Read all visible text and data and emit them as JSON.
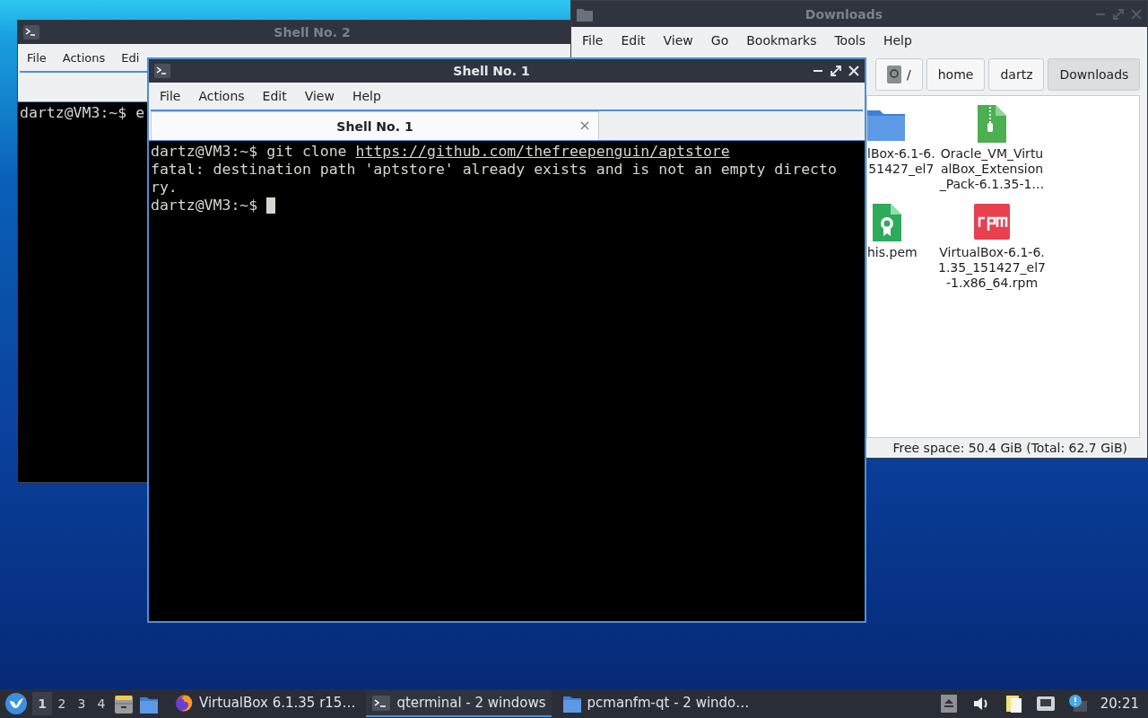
{
  "windows": [
    {
      "kind": "terminal",
      "title": "Shell No. 2",
      "active": false,
      "menu": [
        "File",
        "Actions",
        "Edi"
      ],
      "lines": [
        {
          "text": "dartz@VM3:~$ e"
        }
      ]
    },
    {
      "kind": "files",
      "title": "Downloads",
      "active": false,
      "menu": [
        "File",
        "Edit",
        "View",
        "Go",
        "Bookmarks",
        "Tools",
        "Help"
      ],
      "path": [
        {
          "kind": "root",
          "label": "/",
          "selected": false
        },
        {
          "kind": "dir",
          "label": "home",
          "selected": false
        },
        {
          "kind": "dir",
          "label": "dartz",
          "selected": false
        },
        {
          "kind": "dir",
          "label": "Downloads",
          "selected": true
        }
      ],
      "files": [
        {
          "kind": "folder",
          "lines": [
            "lBox-6.1-6.",
            "51427_el7"
          ]
        },
        {
          "kind": "zip",
          "lines": [
            "Oracle_VM_Virtu",
            "alBox_Extension",
            "_Pack-6.1.35-1…"
          ]
        },
        {
          "kind": "cert",
          "lines": [
            "his.pem"
          ]
        },
        {
          "kind": "rpm",
          "lines": [
            "VirtualBox-6.1-6.",
            "1.35_151427_el7",
            "-1.x86_64.rpm"
          ]
        }
      ],
      "status": "Free space: 50.4 GiB (Total: 62.7 GiB)"
    },
    {
      "kind": "terminal",
      "title": "Shell No. 1",
      "active": true,
      "menu": [
        "File",
        "Actions",
        "Edit",
        "View",
        "Help"
      ],
      "tabs": [
        {
          "label": "Shell No. 1",
          "selected": true
        }
      ],
      "lines": [
        {
          "text": "dartz@VM3:~$ git clone ",
          "link": "https://github.com/thefreepenguin/aptstore"
        },
        {
          "text": "fatal: destination path 'aptstore' already exists and is not an empty directo"
        },
        {
          "text": "ry."
        },
        {
          "text": "dartz@VM3:~$ ",
          "cursor": true
        }
      ]
    }
  ],
  "taskbar": {
    "workspaces": [
      {
        "label": "1",
        "selected": true
      },
      {
        "label": "2",
        "selected": false
      },
      {
        "label": "3",
        "selected": false
      },
      {
        "label": "4",
        "selected": false
      }
    ],
    "launchers": [
      {
        "kind": "cabinet"
      },
      {
        "kind": "folder"
      }
    ],
    "tasks": [
      {
        "kind": "browser",
        "label": "VirtualBox 6.1.35 r15…",
        "selected": false
      },
      {
        "kind": "terminal",
        "label": "qterminal - 2 windows",
        "selected": true
      },
      {
        "kind": "folder",
        "label": "pcmanfm-qt - 2 windo…",
        "selected": false
      }
    ],
    "tray": [
      {
        "kind": "eject"
      },
      {
        "kind": "volume"
      },
      {
        "kind": "clipboard"
      },
      {
        "kind": "network"
      },
      {
        "kind": "notification"
      }
    ],
    "clock": "20:21"
  }
}
